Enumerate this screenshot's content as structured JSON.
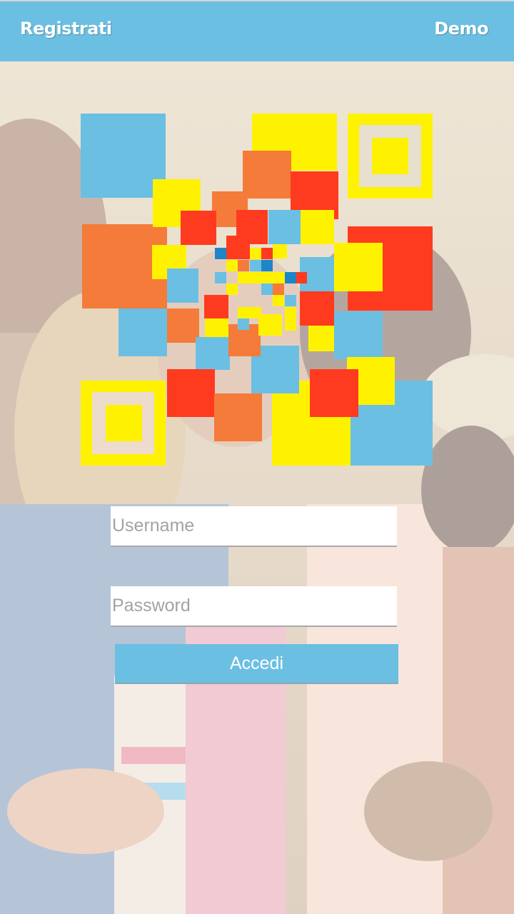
{
  "header": {
    "register_label": "Registrati",
    "demo_label": "Demo"
  },
  "login": {
    "username_placeholder": "Username",
    "password_placeholder": "Password",
    "submit_label": "Accedi"
  },
  "colors": {
    "accent": "#6bbfe3",
    "logo_blue": "#6bbfe3",
    "logo_yellow": "#fff200",
    "logo_orange": "#f47b3a",
    "logo_red": "#ff3b1f",
    "logo_dark_blue": "#1e86c8"
  }
}
